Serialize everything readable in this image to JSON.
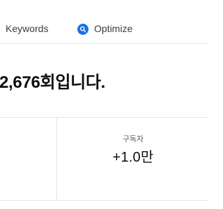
{
  "tabs": {
    "keywords_label": "Keywords",
    "optimize_label": "Optimize",
    "optimize_icon": "optimize-badge-icon",
    "optimize_icon_color": "#1a73e8"
  },
  "headline": "2,676회입니다.",
  "stats": {
    "left": {
      "label": "",
      "value": ""
    },
    "subscribers": {
      "label": "구독자",
      "value": "+1.0만"
    }
  }
}
